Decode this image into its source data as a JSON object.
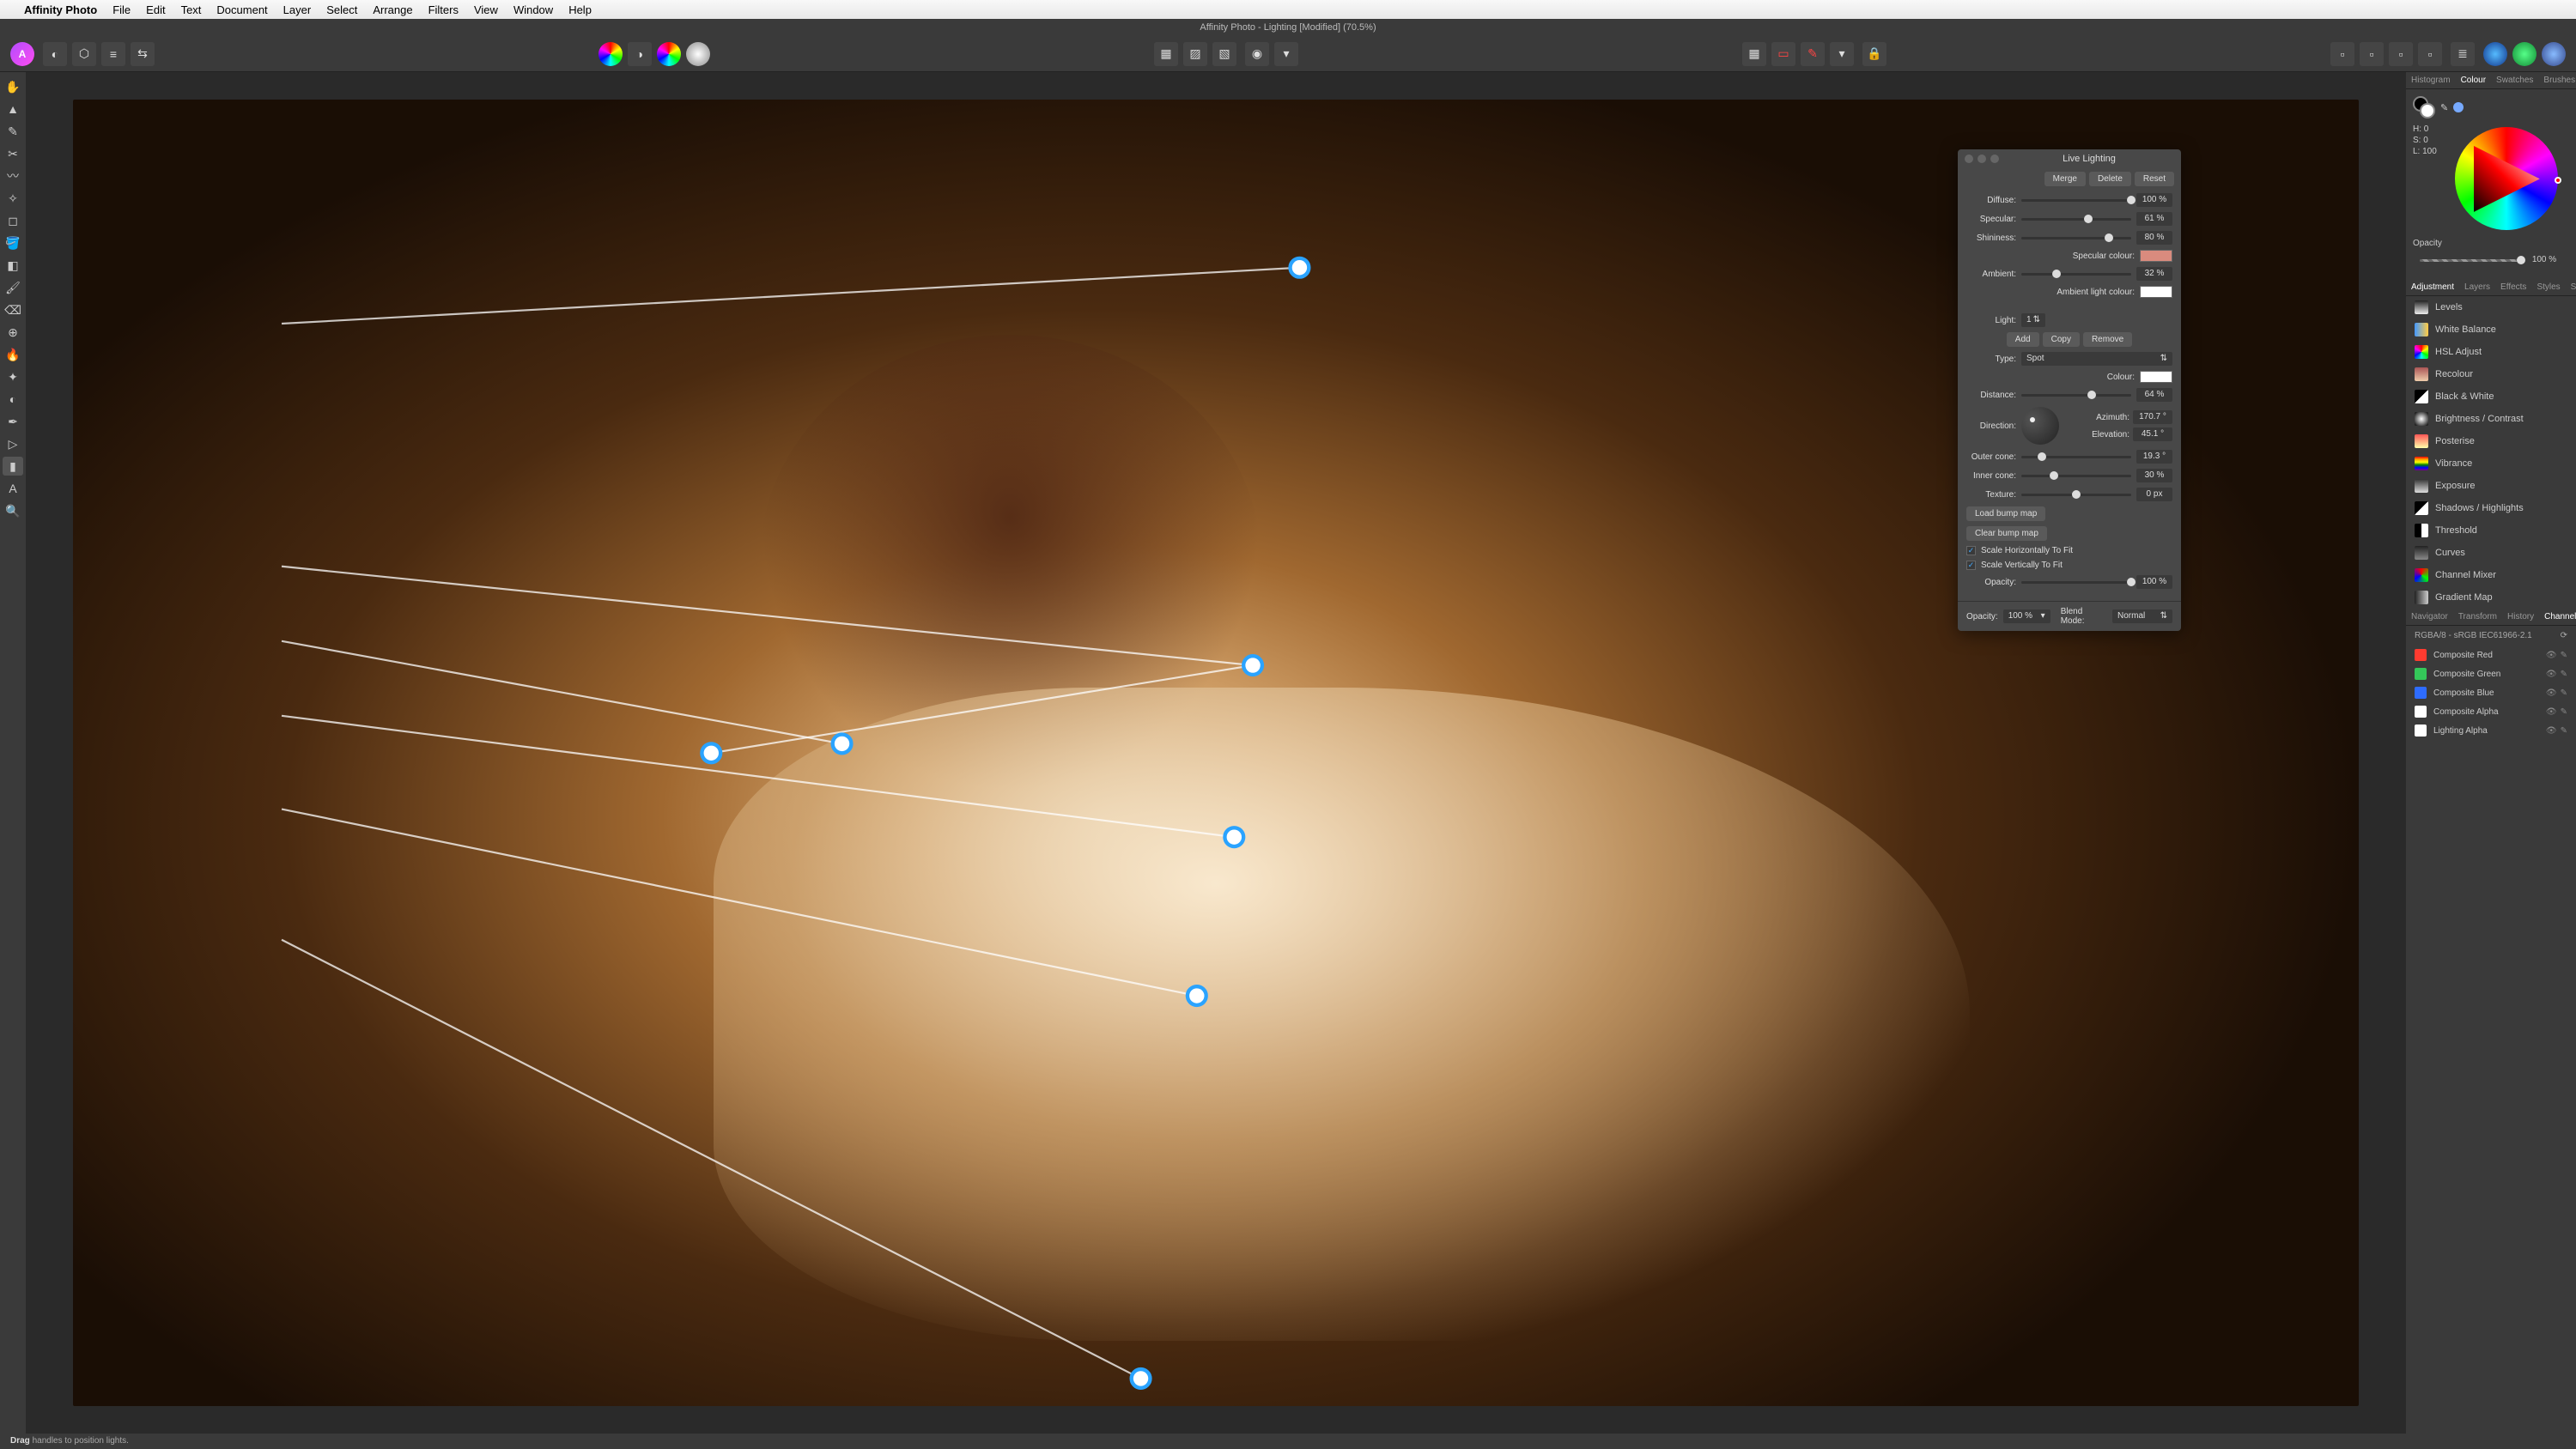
{
  "menubar": {
    "app": "Affinity Photo",
    "items": [
      "File",
      "Edit",
      "Text",
      "Document",
      "Layer",
      "Select",
      "Arrange",
      "Filters",
      "View",
      "Window",
      "Help"
    ]
  },
  "window_title": "Affinity Photo - Lighting [Modified] (70.5%)",
  "panel": {
    "title": "Live Lighting",
    "merge": "Merge",
    "delete": "Delete",
    "reset": "Reset",
    "diffuse": {
      "label": "Diffuse:",
      "value": "100 %",
      "pos": 100
    },
    "specular": {
      "label": "Specular:",
      "value": "61 %",
      "pos": 61
    },
    "shininess": {
      "label": "Shininess:",
      "value": "80 %",
      "pos": 80
    },
    "specular_colour": {
      "label": "Specular colour:",
      "hex": "#d98b7e"
    },
    "ambient": {
      "label": "Ambient:",
      "value": "32 %",
      "pos": 32
    },
    "ambient_colour": {
      "label": "Ambient light colour:",
      "hex": "#ffffff"
    },
    "light": {
      "label": "Light:",
      "value": "1"
    },
    "add": "Add",
    "copy": "Copy",
    "remove": "Remove",
    "type": {
      "label": "Type:",
      "value": "Spot"
    },
    "colour": {
      "label": "Colour:",
      "hex": "#ffffff"
    },
    "distance": {
      "label": "Distance:",
      "value": "64 %",
      "pos": 64
    },
    "direction": {
      "label": "Direction:"
    },
    "azimuth": {
      "label": "Azimuth:",
      "value": "170.7 °"
    },
    "elevation": {
      "label": "Elevation:",
      "value": "45.1 °"
    },
    "outer": {
      "label": "Outer cone:",
      "value": "19.3 °",
      "pos": 19
    },
    "inner": {
      "label": "Inner cone:",
      "value": "30 %",
      "pos": 30
    },
    "texture": {
      "label": "Texture:",
      "value": "0 px",
      "pos": 50
    },
    "load_bump": "Load bump map",
    "clear_bump": "Clear bump map",
    "scale_h": "Scale Horizontally To Fit",
    "scale_v": "Scale Vertically To Fit",
    "opacity": {
      "label": "Opacity:",
      "value": "100 %",
      "pos": 100
    },
    "footer_opacity": {
      "label": "Opacity:",
      "value": "100 %"
    },
    "blend": {
      "label": "Blend Mode:",
      "value": "Normal"
    }
  },
  "right": {
    "tabs_top": [
      "Histogram",
      "Colour",
      "Swatches",
      "Brushes"
    ],
    "hsl": {
      "h": "H: 0",
      "s": "S: 0",
      "l": "L: 100"
    },
    "opacity_label": "Opacity",
    "opacity_value": "100 %",
    "tabs_mid": [
      "Adjustment",
      "Layers",
      "Effects",
      "Styles",
      "Stock"
    ],
    "adjustments": [
      {
        "name": "Levels",
        "c": "linear-gradient(#222,#eee)"
      },
      {
        "name": "White Balance",
        "c": "linear-gradient(90deg,#49f,#fc4)"
      },
      {
        "name": "HSL Adjust",
        "c": "conic-gradient(red,yellow,lime,cyan,blue,magenta,red)"
      },
      {
        "name": "Recolour",
        "c": "linear-gradient(#a55,#eca)"
      },
      {
        "name": "Black & White",
        "c": "linear-gradient(135deg,#000 49%,#fff 50%)"
      },
      {
        "name": "Brightness / Contrast",
        "c": "radial-gradient(#fff,#000)"
      },
      {
        "name": "Posterise",
        "c": "linear-gradient(#f55,#ffa)"
      },
      {
        "name": "Vibrance",
        "c": "linear-gradient(red,orange,yellow,green,blue,purple)"
      },
      {
        "name": "Exposure",
        "c": "linear-gradient(#333,#ddd)"
      },
      {
        "name": "Shadows / Highlights",
        "c": "linear-gradient(135deg,#000 49%,#fff 50%)"
      },
      {
        "name": "Threshold",
        "c": "linear-gradient(90deg,#000 49%,#fff 50%)"
      },
      {
        "name": "Curves",
        "c": "linear-gradient(#222,#888)"
      },
      {
        "name": "Channel Mixer",
        "c": "conic-gradient(#f00,#0f0,#00f,#f00)"
      },
      {
        "name": "Gradient Map",
        "c": "linear-gradient(90deg,#222,#ccc)"
      }
    ],
    "tabs_bot": [
      "Navigator",
      "Transform",
      "History",
      "Channels"
    ],
    "profile": "RGBA/8 - sRGB IEC61966-2.1",
    "channels": [
      {
        "name": "Composite Red",
        "c": "#ff3b30"
      },
      {
        "name": "Composite Green",
        "c": "#34c759"
      },
      {
        "name": "Composite Blue",
        "c": "#2e6cff"
      },
      {
        "name": "Composite Alpha",
        "c": "#ffffff"
      },
      {
        "name": "Lighting Alpha",
        "c": "#ffffff"
      }
    ]
  },
  "status": {
    "bold": "Drag",
    "rest": " handles to position lights."
  }
}
